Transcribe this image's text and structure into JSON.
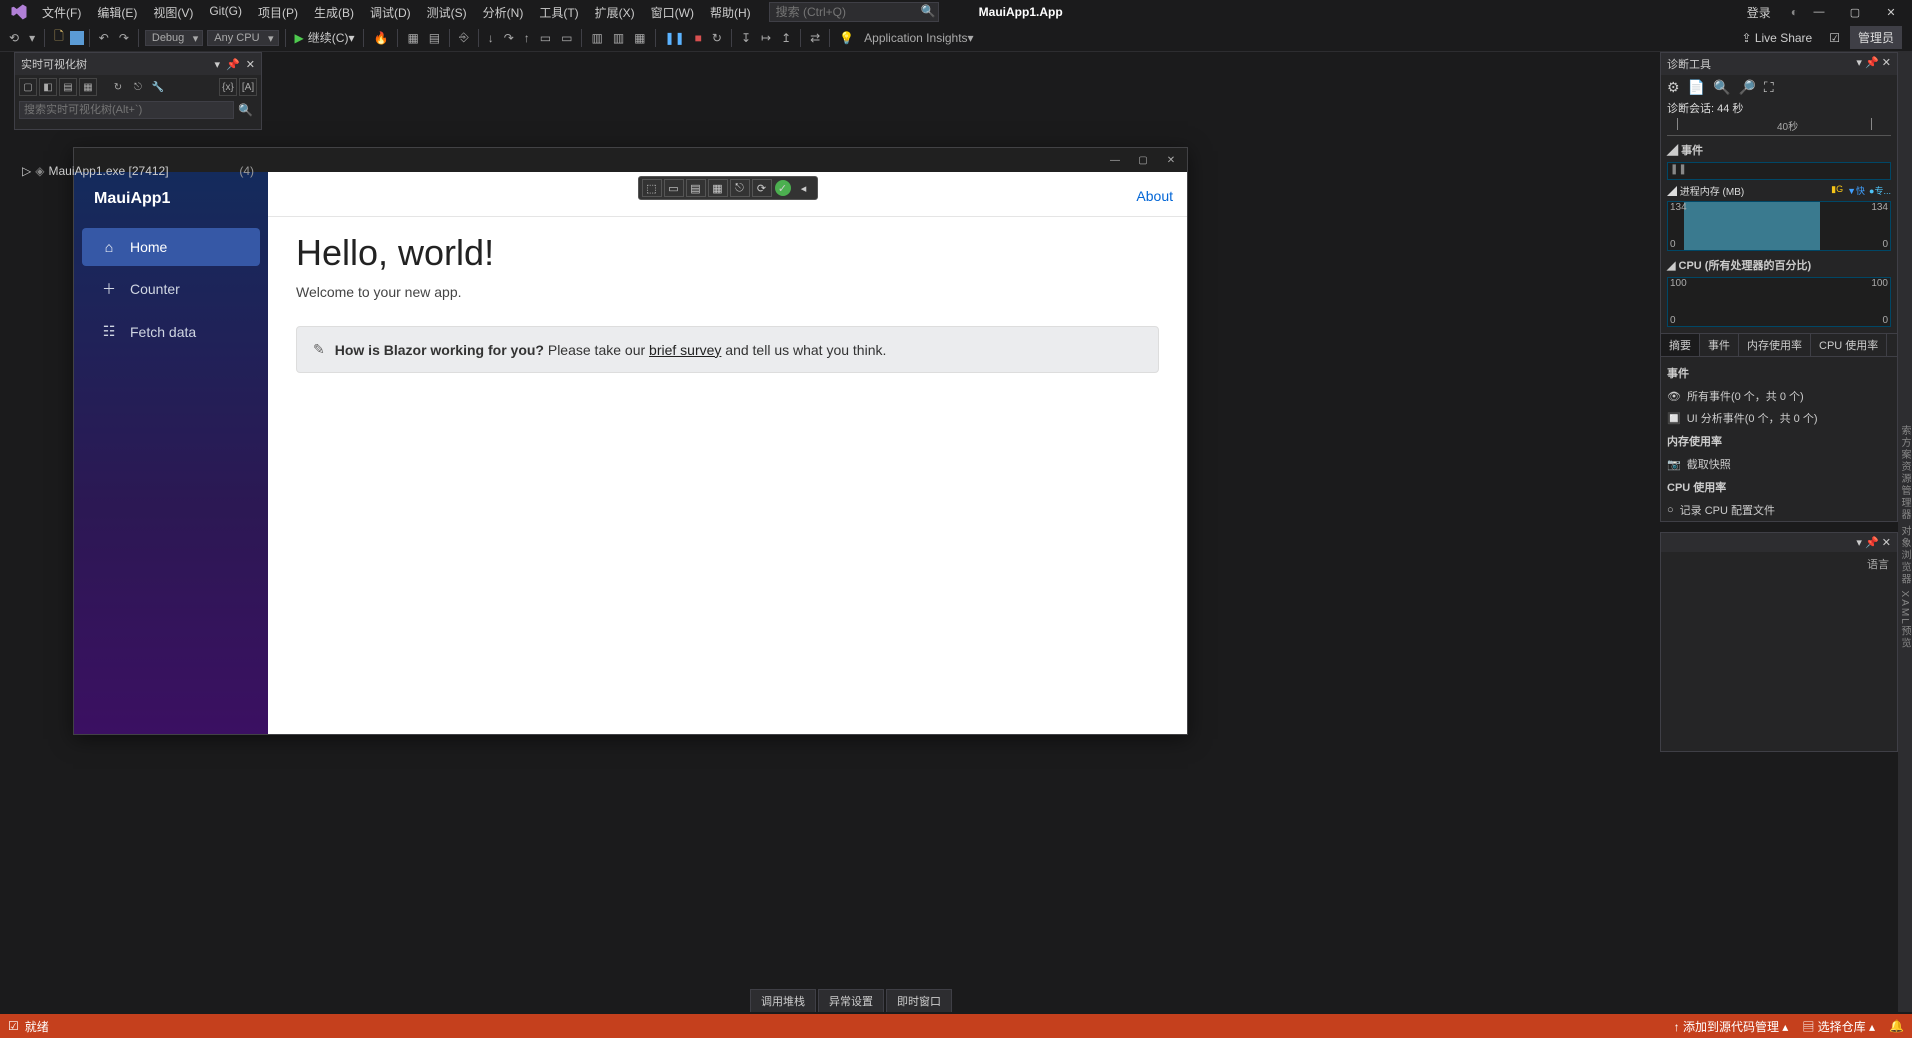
{
  "menu": [
    "文件(F)",
    "编辑(E)",
    "视图(V)",
    "Git(G)",
    "项目(P)",
    "生成(B)",
    "调试(D)",
    "测试(S)",
    "分析(N)",
    "工具(T)",
    "扩展(X)",
    "窗口(W)",
    "帮助(H)"
  ],
  "search_placeholder": "搜索 (Ctrl+Q)",
  "app_title": "MauiApp1.App",
  "login": "登录",
  "toolbar": {
    "config": "Debug",
    "platform": "Any CPU",
    "continue": "继续(C)",
    "insights": "Application Insights",
    "liveshare": "Live Share",
    "admin": "管理员"
  },
  "left": {
    "title": "实时可视化树",
    "search": "搜索实时可视化树(Alt+`)",
    "tree": "MauiApp1.exe [27412]",
    "count": "(4)"
  },
  "app": {
    "brand": "MauiApp1",
    "nav": [
      {
        "icon": "⌂",
        "label": "Home",
        "active": true
      },
      {
        "icon": "＋",
        "label": "Counter"
      },
      {
        "icon": "☷",
        "label": "Fetch data"
      }
    ],
    "about": "About",
    "h1": "Hello, world!",
    "welcome": "Welcome to your new app.",
    "banner_q": "How is Blazor working for you?",
    "banner_pre": " Please take our ",
    "banner_link": "brief survey",
    "banner_post": " and tell us what you think."
  },
  "diag": {
    "title": "诊断工具",
    "session": "诊断会话: 44 秒",
    "ruler": "40秒",
    "events": "事件",
    "mem_h": "进程内存 (MB)",
    "mem_flags": {
      "g": "G",
      "fast": "快",
      "pro": "专..."
    },
    "mem_val": "134",
    "mem_zero": "0",
    "cpu_h": "CPU (所有处理器的百分比)",
    "cpu_hi": "100",
    "cpu_lo": "0",
    "tabs": [
      "摘要",
      "事件",
      "内存使用率",
      "CPU 使用率"
    ],
    "evt_h": "事件",
    "evt1": "所有事件(0 个，共 0 个)",
    "evt2": "UI 分析事件(0 个，共 0 个)",
    "memu_h": "内存使用率",
    "memu1": "截取快照",
    "cpuu_h": "CPU 使用率",
    "cpuu1": "记录 CPU 配置文件"
  },
  "lang": "语言",
  "vbar": "索方案资源管理器  对象浏览器  XAML预览",
  "bottom_tabs": [
    "调用堆栈",
    "异常设置",
    "即时窗口"
  ],
  "status": {
    "ready": "就绪",
    "src": "添加到源代码管理",
    "repo": "选择仓库"
  }
}
